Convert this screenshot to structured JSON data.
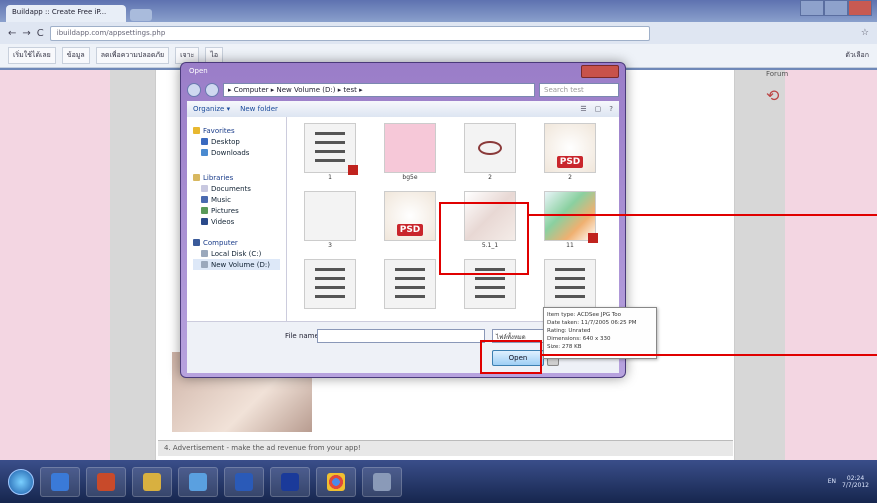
{
  "browser": {
    "tab_title": "Buildapp :: Create Free iP...",
    "url": "ibuildapp.com/appsettings.php",
    "bookmarks": [
      "เริ่มใช้ได้เลย",
      "ข้อมูล",
      "ลดเพื่อความปลอดภัย",
      "เจาะ",
      "ไอ"
    ],
    "bookmarks_right": "ตัวเลือก"
  },
  "page": {
    "right_label": "Forum",
    "section4": "4. Advertisement - make the ad revenue from your app!"
  },
  "dialog": {
    "title": "Open",
    "breadcrumb": "▸ Computer ▸ New Volume (D:) ▸ test ▸",
    "search_placeholder": "Search test",
    "organize": "Organize ▾",
    "new_folder": "New folder",
    "nav": {
      "favorites": "Favorites",
      "favorites_items": [
        "Desktop",
        "Downloads"
      ],
      "libraries": "Libraries",
      "libraries_items": [
        "Documents",
        "Music",
        "Pictures",
        "Videos"
      ],
      "computer": "Computer",
      "computer_items": [
        "Local Disk (C:)",
        "New Volume (D:)"
      ]
    },
    "files": [
      {
        "name": "1",
        "kind": "doc-pdf"
      },
      {
        "name": "bg5e",
        "kind": "pink"
      },
      {
        "name": "2",
        "kind": "logo"
      },
      {
        "name": "2",
        "kind": "psd"
      },
      {
        "name": "3",
        "kind": "blank"
      },
      {
        "name": "",
        "kind": "psd"
      },
      {
        "name": "5.1_1",
        "kind": "photo"
      },
      {
        "name": "11",
        "kind": "colorful-pdf"
      },
      {
        "name": "",
        "kind": "doc"
      },
      {
        "name": "",
        "kind": "doc"
      },
      {
        "name": "",
        "kind": "doc"
      },
      {
        "name": "",
        "kind": "doc"
      }
    ],
    "tooltip": [
      "Item type: ACDSee JPG Too",
      "Date taken: 11/7/2005 06:25 PM",
      "Rating: Unrated",
      "Dimensions: 640 x 330",
      "Size: 278 KB"
    ],
    "file_name_label": "File name:",
    "file_type": "ไฟล์ทั้งหมด",
    "open_button": "Open"
  },
  "taskbar": {
    "tray_text": "EN",
    "time": "02:24",
    "date": "7/7/2012"
  },
  "colors": {
    "highlight": "#e00000",
    "dialog_frame": "#9a7dc8"
  }
}
